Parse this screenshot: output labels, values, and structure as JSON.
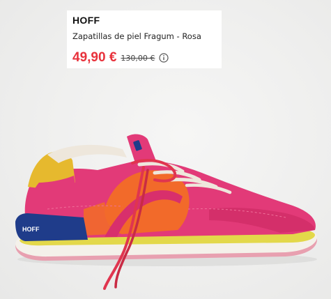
{
  "product": {
    "brand": "HOFF",
    "name": "Zapatillas de piel Fragum - Rosa",
    "price_current": "49,90 €",
    "price_original": "130,00 €",
    "info_icon": "info-circle-icon"
  },
  "image": {
    "subject": "sneaker-photo",
    "tongue_logo": "HOFF",
    "colors": {
      "suede_pink": "#e23a78",
      "suede_orange": "#f26a2a",
      "heel_yellow": "#e6b92e",
      "heel_navy": "#1f3c8a",
      "sole_white": "#f4f1ea",
      "sole_yellow": "#e3d84a",
      "sole_pink": "#e8a0b0",
      "lace_white": "#eee7dc",
      "lace_red": "#e0354f"
    }
  }
}
